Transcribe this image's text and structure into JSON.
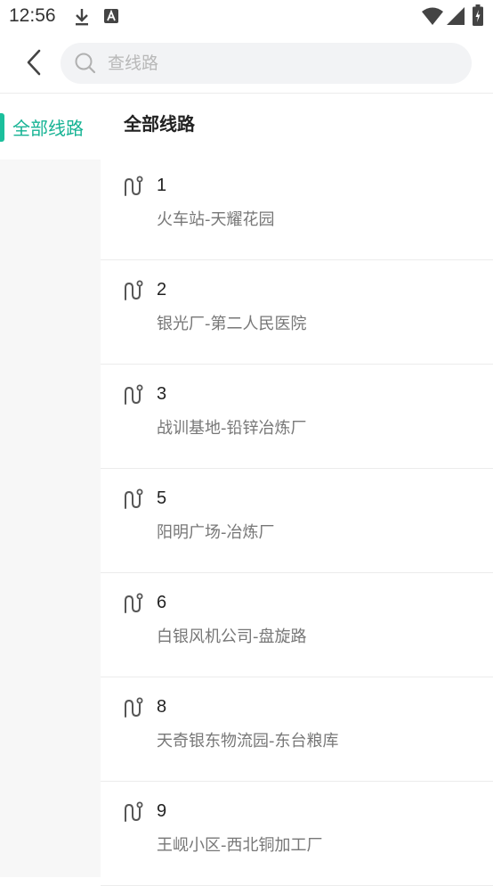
{
  "status_bar": {
    "time": "12:56",
    "left_icons": [
      "download-icon",
      "app-notification-icon"
    ],
    "right_icons": [
      "wifi-icon",
      "signal-icon",
      "battery-icon"
    ]
  },
  "header": {
    "back_icon": "chevron-left-icon",
    "search": {
      "placeholder": "查线路",
      "value": ""
    }
  },
  "sidebar": {
    "items": [
      {
        "label": "全部线路",
        "selected": true
      }
    ]
  },
  "main": {
    "section_title": "全部线路",
    "routes": [
      {
        "number": "1",
        "stops": "火车站-天耀花园"
      },
      {
        "number": "2",
        "stops": "银光厂-第二人民医院"
      },
      {
        "number": "3",
        "stops": "战训基地-铅锌冶炼厂"
      },
      {
        "number": "5",
        "stops": "阳明广场-冶炼厂"
      },
      {
        "number": "6",
        "stops": "白银风机公司-盘旋路"
      },
      {
        "number": "8",
        "stops": "天奇银东物流园-东台粮库"
      },
      {
        "number": "9",
        "stops": "王岘小区-西北铜加工厂"
      }
    ]
  },
  "colors": {
    "accent": "#16b394",
    "text_primary": "#222222",
    "text_secondary": "#777777",
    "search_bg": "#f2f3f5",
    "sidebar_bg": "#f7f7f7"
  }
}
